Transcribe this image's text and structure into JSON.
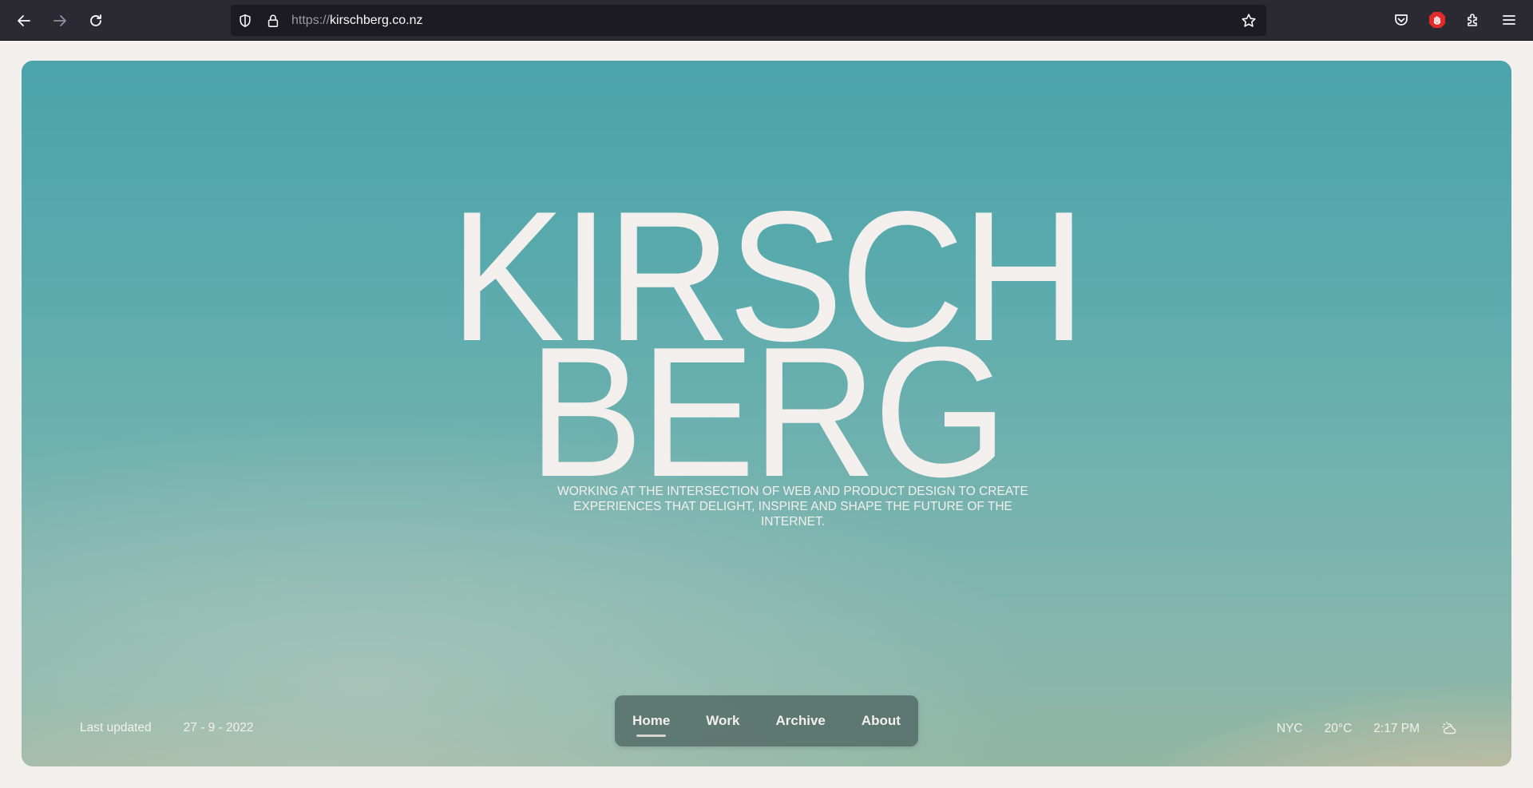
{
  "browser": {
    "url_protocol": "https://",
    "url_host": "kirschberg.co.nz"
  },
  "icons": {
    "back": "arrow-left-icon",
    "forward": "arrow-right-icon",
    "reload": "reload-icon",
    "shield": "shield-icon",
    "lock": "lock-icon",
    "bookmark": "star-icon",
    "pocket": "pocket-icon",
    "extension_stop": "stop-hand-icon",
    "extensions": "puzzle-icon",
    "menu": "hamburger-menu-icon",
    "weather": "partly-cloudy-icon"
  },
  "hero": {
    "title_line1": "KIRSCH",
    "title_line2": "BERG",
    "tagline": "WORKING AT THE INTERSECTION OF WEB AND PRODUCT DESIGN TO CREATE EXPERIENCES THAT DELIGHT, INSPIRE AND SHAPE THE FUTURE OF THE INTERNET."
  },
  "footer": {
    "updated_label": "Last updated",
    "updated_date": "27 - 9 - 2022",
    "city": "NYC",
    "temperature": "20°C",
    "time": "2:17 PM"
  },
  "nav": {
    "items": [
      {
        "label": "Home",
        "active": true
      },
      {
        "label": "Work",
        "active": false
      },
      {
        "label": "Archive",
        "active": false
      },
      {
        "label": "About",
        "active": false
      }
    ]
  },
  "colors": {
    "toolbar": "#2b2a33",
    "urlbar": "#1c1b22",
    "hero_top": "#4aa4a9",
    "hero_text": "#f3efec",
    "nav_pill": "#50696a",
    "stop_badge": "#e22b2b"
  }
}
